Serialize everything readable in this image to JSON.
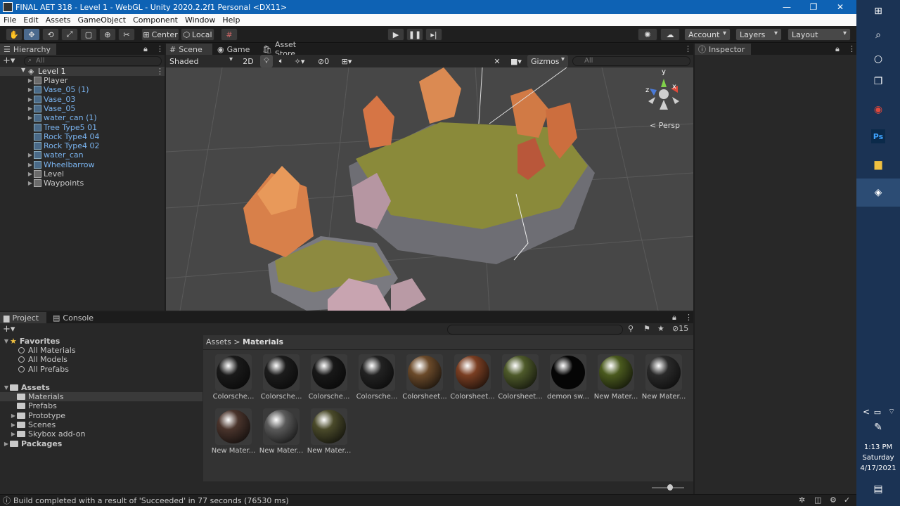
{
  "window": {
    "title": "FINAL AET 318 - Level 1 - WebGL - Unity 2020.2.2f1 Personal <DX11>",
    "minimize": "—",
    "maximize": "❐",
    "close": "✕"
  },
  "menu": [
    "File",
    "Edit",
    "Assets",
    "GameObject",
    "Component",
    "Window",
    "Help"
  ],
  "toolbar": {
    "pivot": "Center",
    "space": "Local",
    "account": "Account",
    "layers": "Layers",
    "layout": "Layout"
  },
  "hierarchy": {
    "tab": "Hierarchy",
    "search_placeholder": "All",
    "scene": "Level 1",
    "items": [
      {
        "label": "Player",
        "color": "#c8c8c8",
        "arrow": true
      },
      {
        "label": "Vase_05 (1)",
        "color": "#7ab4f0",
        "arrow": true
      },
      {
        "label": "Vase_03",
        "color": "#7ab4f0",
        "arrow": true
      },
      {
        "label": "Vase_05",
        "color": "#7ab4f0",
        "arrow": true
      },
      {
        "label": "water_can (1)",
        "color": "#7ab4f0",
        "arrow": true
      },
      {
        "label": "Tree Type5 01",
        "color": "#7ab4f0",
        "arrow": false
      },
      {
        "label": "Rock Type4 04",
        "color": "#7ab4f0",
        "arrow": false
      },
      {
        "label": "Rock Type4 02",
        "color": "#7ab4f0",
        "arrow": false
      },
      {
        "label": "water_can",
        "color": "#7ab4f0",
        "arrow": true
      },
      {
        "label": "Wheelbarrow",
        "color": "#7ab4f0",
        "arrow": true
      },
      {
        "label": "Level",
        "color": "#c8c8c8",
        "arrow": true
      },
      {
        "label": "Waypoints",
        "color": "#c8c8c8",
        "arrow": true
      }
    ]
  },
  "scene_view": {
    "tabs": [
      "Scene",
      "Game",
      "Asset Store"
    ],
    "shading": "Shaded",
    "mode_2d": "2D",
    "hidden_count": "0",
    "gizmos": "Gizmos",
    "search_placeholder": "All",
    "projection": "Persp",
    "axis_x": "x",
    "axis_y": "y",
    "axis_z": "z"
  },
  "inspector": {
    "tab": "Inspector"
  },
  "project": {
    "tabs": [
      "Project",
      "Console"
    ],
    "hidden_count": "15",
    "breadcrumb_root": "Assets",
    "breadcrumb_sep": ">",
    "breadcrumb_current": "Materials",
    "favorites_label": "Favorites",
    "favorites": [
      "All Materials",
      "All Models",
      "All Prefabs"
    ],
    "assets_label": "Assets",
    "asset_folders": [
      {
        "label": "Materials",
        "arrow": false,
        "selected": true
      },
      {
        "label": "Prefabs",
        "arrow": false,
        "selected": false
      },
      {
        "label": "Prototype",
        "arrow": true,
        "selected": false
      },
      {
        "label": "Scenes",
        "arrow": true,
        "selected": false
      },
      {
        "label": "Skybox add-on",
        "arrow": true,
        "selected": false
      }
    ],
    "packages_label": "Packages",
    "materials": [
      {
        "label": "Colorsche...",
        "color": "#1a1a1a"
      },
      {
        "label": "Colorsche...",
        "color": "#1c1c1c"
      },
      {
        "label": "Colorsche...",
        "color": "#181818"
      },
      {
        "label": "Colorsche...",
        "color": "#222222"
      },
      {
        "label": "Colorsheet...",
        "color": "#6b4a2a"
      },
      {
        "label": "Colorsheet...",
        "color": "#7a3e22"
      },
      {
        "label": "Colorsheet...",
        "color": "#4e5a2a"
      },
      {
        "label": "demon sw...",
        "color": "#050505"
      },
      {
        "label": "New Mater...",
        "color": "#4a5a1e"
      },
      {
        "label": "New Mater...",
        "color": "#2a2a2a"
      },
      {
        "label": "New Mater...",
        "color": "#4a342c"
      },
      {
        "label": "New Mater...",
        "color": "#5a5a5a"
      },
      {
        "label": "New Mater...",
        "color": "#4a4a2a"
      }
    ]
  },
  "status": {
    "message": "Build completed with a result of 'Succeeded' in 77 seconds (76530 ms)"
  },
  "taskbar": {
    "time": "1:13 PM",
    "day": "Saturday",
    "date": "4/17/2021",
    "ps_label": "Ps"
  }
}
